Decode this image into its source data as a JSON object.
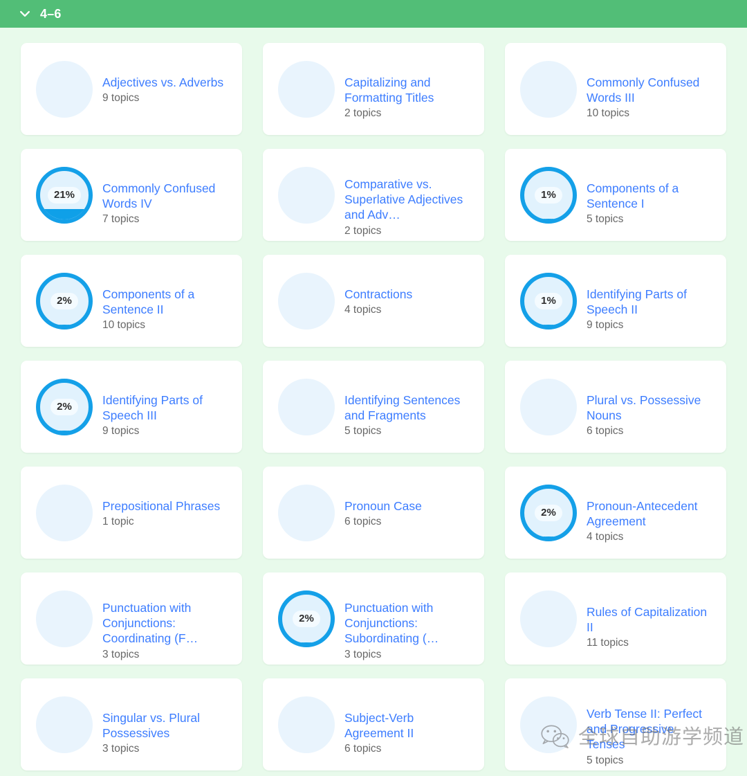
{
  "header": {
    "grade_label": "4–6",
    "chevron_icon": "chevron-down-icon",
    "background_color": "#52be77",
    "text_color": "#ffffff"
  },
  "theme": {
    "page_background": "#e8faeb",
    "card_background": "#ffffff",
    "link_color": "#3d7dff",
    "progress_color": "#0fa0e8",
    "progress_track_color": "#e9f4fd",
    "muted_text_color": "#676767"
  },
  "cards": [
    {
      "title": "Adjectives vs. Adverbs",
      "topics": "9 topics",
      "progress": null,
      "progress_label": ""
    },
    {
      "title": "Capitalizing and Formatting Titles",
      "topics": "2 topics",
      "progress": null,
      "progress_label": ""
    },
    {
      "title": "Commonly Confused Words III",
      "topics": "10 topics",
      "progress": null,
      "progress_label": ""
    },
    {
      "title": "Commonly Confused Words IV",
      "topics": "7 topics",
      "progress": 21,
      "progress_label": "21%"
    },
    {
      "title": "Comparative vs. Superlative Adjectives and Adv…",
      "topics": "2 topics",
      "progress": null,
      "progress_label": ""
    },
    {
      "title": "Components of a Sentence I",
      "topics": "5 topics",
      "progress": 1,
      "progress_label": "1%"
    },
    {
      "title": "Components of a Sentence II",
      "topics": "10 topics",
      "progress": 2,
      "progress_label": "2%"
    },
    {
      "title": "Contractions",
      "topics": "4 topics",
      "progress": null,
      "progress_label": ""
    },
    {
      "title": "Identifying Parts of Speech II",
      "topics": "9 topics",
      "progress": 1,
      "progress_label": "1%"
    },
    {
      "title": "Identifying Parts of Speech III",
      "topics": "9 topics",
      "progress": 2,
      "progress_label": "2%"
    },
    {
      "title": "Identifying Sentences and Fragments",
      "topics": "5 topics",
      "progress": null,
      "progress_label": ""
    },
    {
      "title": "Plural vs. Possessive Nouns",
      "topics": "6 topics",
      "progress": null,
      "progress_label": ""
    },
    {
      "title": "Prepositional Phrases",
      "topics": "1 topic",
      "progress": null,
      "progress_label": ""
    },
    {
      "title": "Pronoun Case",
      "topics": "6 topics",
      "progress": null,
      "progress_label": ""
    },
    {
      "title": "Pronoun-Antecedent Agreement",
      "topics": "4 topics",
      "progress": 2,
      "progress_label": "2%"
    },
    {
      "title": "Punctuation with Conjunctions: Coordinating (F…",
      "topics": "3 topics",
      "progress": null,
      "progress_label": ""
    },
    {
      "title": "Punctuation with Conjunctions: Subordinating (…",
      "topics": "3 topics",
      "progress": 2,
      "progress_label": "2%"
    },
    {
      "title": "Rules of Capitalization II",
      "topics": "11 topics",
      "progress": null,
      "progress_label": ""
    },
    {
      "title": "Singular vs. Plural Possessives",
      "topics": "3 topics",
      "progress": null,
      "progress_label": ""
    },
    {
      "title": "Subject-Verb Agreement II",
      "topics": "6 topics",
      "progress": null,
      "progress_label": ""
    },
    {
      "title": "Verb Tense II: Perfect and Progressive Tenses",
      "topics": "5 topics",
      "progress": null,
      "progress_label": ""
    }
  ],
  "watermark": {
    "text": "全球自助游学频道",
    "logo_icon": "wechat-icon"
  }
}
